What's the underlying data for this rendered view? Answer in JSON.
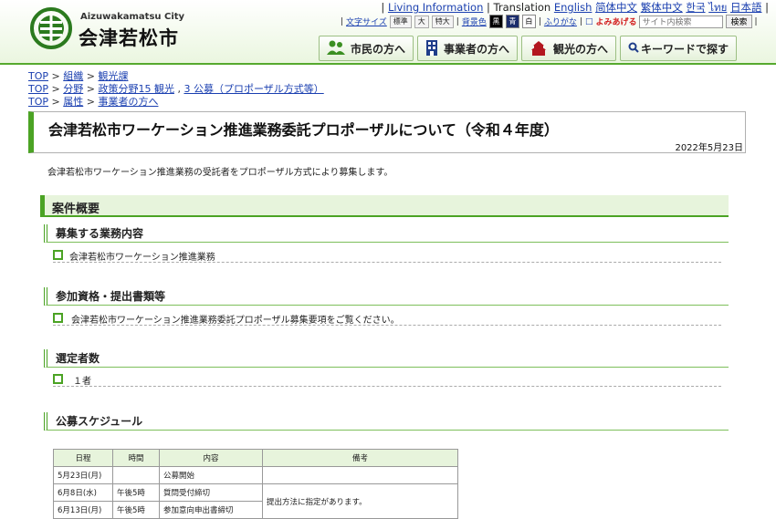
{
  "header": {
    "logo_en": "Aizuwakamatsu City",
    "logo_ja": "会津若松市",
    "links": {
      "living": "Living Information",
      "translation": "Translation",
      "langs": [
        "English",
        "简体中文",
        "繁体中文",
        "한국",
        "ไทย",
        "日本語"
      ]
    },
    "textsize_label": "文字サイズ",
    "sizes": [
      "標準",
      "大",
      "特大"
    ],
    "bgcolor_label": "背景色",
    "colors": [
      "黒",
      "青",
      "白"
    ],
    "furigana": "ふりがな",
    "yomiage": "よみあげる",
    "search_placeholder": "サイト内検索",
    "search_button": "検索",
    "nav": [
      {
        "label": "市民の方へ",
        "icon": "people-icon"
      },
      {
        "label": "事業者の方へ",
        "icon": "building-icon"
      },
      {
        "label": "観光の方へ",
        "icon": "castle-icon"
      },
      {
        "label": "キーワードで探す",
        "icon": "search-icon"
      }
    ]
  },
  "breadcrumbs": [
    {
      "top": "TOP",
      "items": [
        "組織",
        "観光課"
      ]
    },
    {
      "top": "TOP",
      "items": [
        "分野",
        "政策分野15 観光",
        "3 公募（プロポーザル方式等）"
      ]
    },
    {
      "top": "TOP",
      "items": [
        "属性",
        "事業者の方へ"
      ]
    }
  ],
  "page": {
    "title": "会津若松市ワーケーション推進業務委託プロポーザルについて（令和４年度）",
    "date": "2022年5月23日",
    "intro": "会津若松市ワーケーション推進業務の受託者をプロポーザル方式により募集します。"
  },
  "sections": {
    "overview": "案件概要",
    "content_heading": "募集する業務内容",
    "content_item": "会津若松市ワーケーション推進業務",
    "qual_heading": "参加資格・提出書類等",
    "qual_item": "会津若松市ワーケーション推進業務委託プロポーザル募集要項をご覧ください。",
    "count_heading": "選定者数",
    "count_item": "１者",
    "schedule_heading": "公募スケジュール"
  },
  "schedule": {
    "headers": [
      "日程",
      "時間",
      "内容",
      "備考"
    ],
    "rows": [
      {
        "date": "5月23日(月)",
        "time": "",
        "content": "公募開始",
        "note": ""
      },
      {
        "date": "6月8日(水)",
        "time": "午後5時",
        "content": "質問受付締切",
        "note": "提出方法に指定があります。"
      },
      {
        "date": "6月13日(月)",
        "time": "午後5時",
        "content": "参加意向申出書締切",
        "note": ""
      }
    ]
  },
  "colors": {
    "accent": "#4ba324",
    "light": "#e7f4dc",
    "link": "#1a3fb0"
  }
}
